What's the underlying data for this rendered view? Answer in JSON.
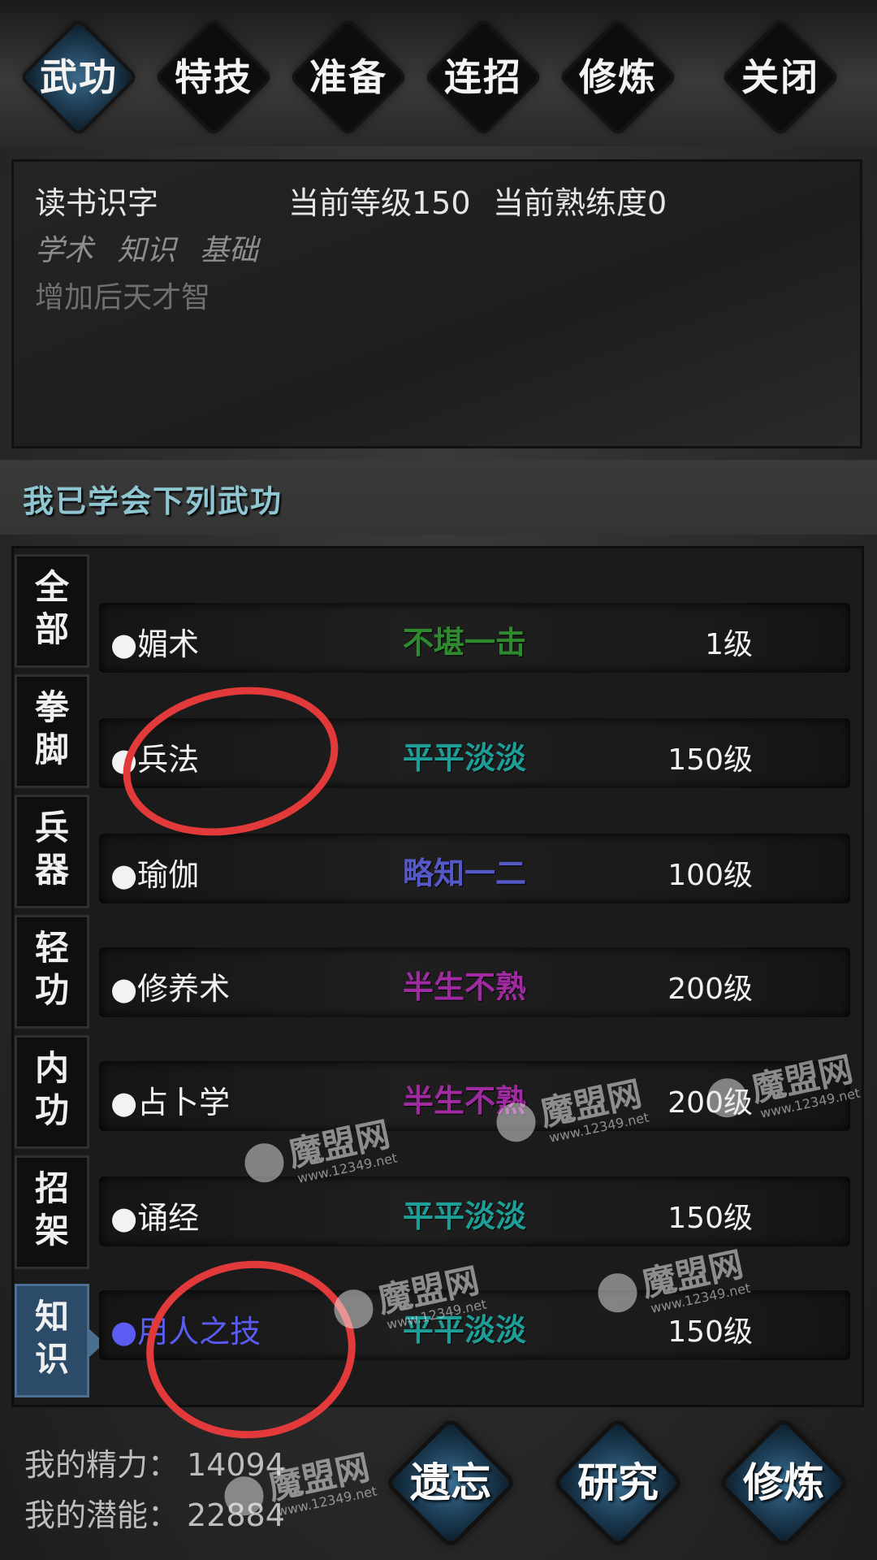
{
  "tabs": [
    {
      "label": "武功",
      "active": true
    },
    {
      "label": "特技",
      "active": false
    },
    {
      "label": "准备",
      "active": false
    },
    {
      "label": "连招",
      "active": false
    },
    {
      "label": "修炼",
      "active": false
    },
    {
      "label": "关闭",
      "active": false
    }
  ],
  "info": {
    "skill_name": "读书识字",
    "level_text": "当前等级150",
    "proficiency_text": "当前熟练度0",
    "tags": [
      "学术",
      "知识",
      "基础"
    ],
    "description": "增加后天才智"
  },
  "section_title": "我已学会下列武功",
  "categories": [
    {
      "label": "全\n部",
      "active": false
    },
    {
      "label": "拳\n脚",
      "active": false
    },
    {
      "label": "兵\n器",
      "active": false
    },
    {
      "label": "轻\n功",
      "active": false
    },
    {
      "label": "内\n功",
      "active": false
    },
    {
      "label": "招\n架",
      "active": false
    },
    {
      "label": "知\n识",
      "active": true
    }
  ],
  "skills": [
    {
      "name": "●媚术",
      "rank": "不堪一击",
      "rank_color": "#2f8a2f",
      "level": "1级"
    },
    {
      "name": "●兵法",
      "rank": "平平淡淡",
      "rank_color": "#1e9e98",
      "level": "150级"
    },
    {
      "name": "●瑜伽",
      "rank": "略知一二",
      "rank_color": "#5559c8",
      "level": "100级"
    },
    {
      "name": "●修养术",
      "rank": "半生不熟",
      "rank_color": "#a02aa0",
      "level": "200级"
    },
    {
      "name": "●占卜学",
      "rank": "半生不熟",
      "rank_color": "#a02aa0",
      "level": "200级"
    },
    {
      "name": "●诵经",
      "rank": "平平淡淡",
      "rank_color": "#1e9e98",
      "level": "150级"
    },
    {
      "name": "●用人之技",
      "rank": "平平淡淡",
      "rank_color": "#1e9e98",
      "level": "150级",
      "selected": true
    }
  ],
  "stats": {
    "energy_label": "我的精力：",
    "energy_value": "14094",
    "potential_label": "我的潜能：",
    "potential_value": "22884"
  },
  "actions": [
    {
      "label": "遗忘"
    },
    {
      "label": "研究"
    },
    {
      "label": "修炼"
    }
  ],
  "watermark": {
    "text": "魔盟网",
    "sub": "www.12349.net"
  }
}
